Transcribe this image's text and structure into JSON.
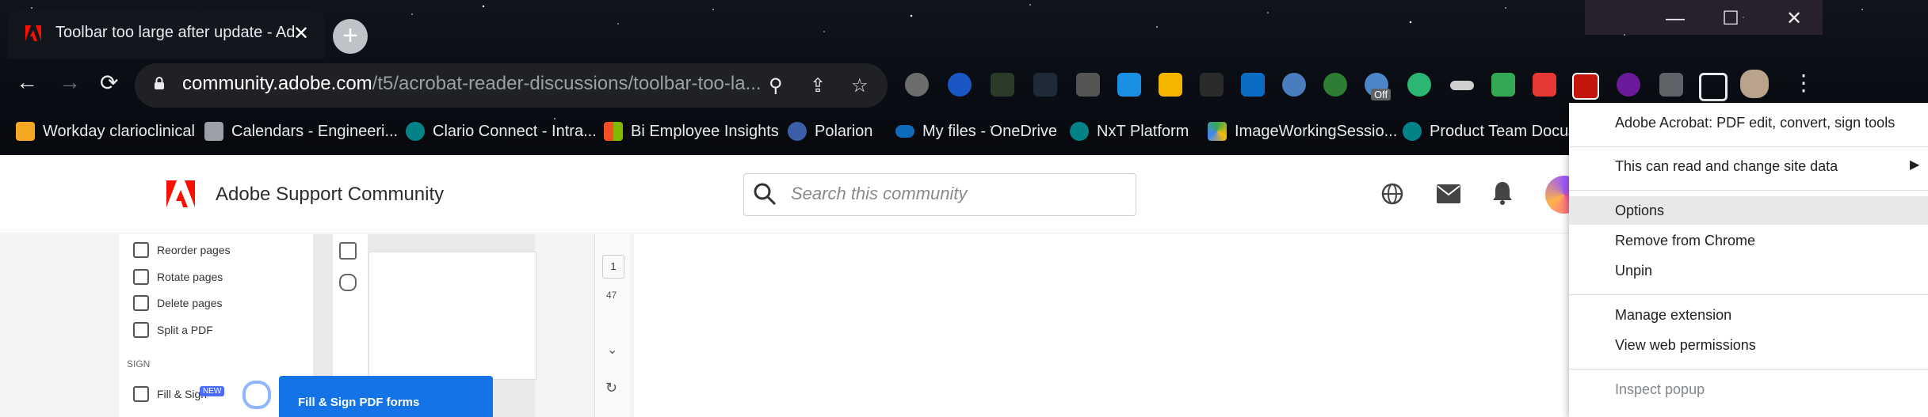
{
  "browser": {
    "tab_title": "Toolbar too large after update - Ad",
    "tab_close": "✕",
    "new_tab": "+",
    "window_controls": [
      "—",
      "☐",
      "✕"
    ],
    "url_host": "community.adobe.com",
    "url_path": "/t5/acrobat-reader-discussions/toolbar-too-la...",
    "ext_badge": "Off"
  },
  "bookmarks": [
    {
      "label": "Workday clarioclinical",
      "color": "#f5a623"
    },
    {
      "label": "Calendars - Engineeri...",
      "color": "#9aa0a6"
    },
    {
      "label": "Clario Connect - Intra...",
      "color": "#038387"
    },
    {
      "label": "Bi Employee Insights",
      "color": "#f25022"
    },
    {
      "label": "Polarion",
      "color": "#3a5ea8"
    },
    {
      "label": "My files - OneDrive",
      "color": "#0f6cbd"
    },
    {
      "label": "NxT Platform",
      "color": "#038387"
    },
    {
      "label": "ImageWorkingSessio...",
      "color": "#34a853"
    },
    {
      "label": "Product Team Docum",
      "color": "#038387"
    }
  ],
  "site": {
    "title": "Adobe Support Community",
    "search_placeholder": "Search this community",
    "brand_color": "#fa0f00"
  },
  "embedded": {
    "side_items": [
      "Reorder pages",
      "Rotate pages",
      "Delete pages",
      "Split a PDF"
    ],
    "section": "SIGN",
    "fill_item": "Fill & Sign",
    "new_badge": "NEW",
    "fill_button": "Fill & Sign PDF forms",
    "page_box": "1",
    "page_count": "47"
  },
  "context_menu": {
    "items": [
      {
        "label": "Adobe Acrobat: PDF edit, convert, sign tools"
      },
      {
        "label": "This can read and change site data",
        "submenu": true
      },
      {
        "label": "Options",
        "highlighted": true
      },
      {
        "label": "Remove from Chrome"
      },
      {
        "label": "Unpin"
      },
      {
        "label": "Manage extension"
      },
      {
        "label": "View web permissions"
      },
      {
        "label": "Inspect popup",
        "disabled": true
      }
    ]
  }
}
